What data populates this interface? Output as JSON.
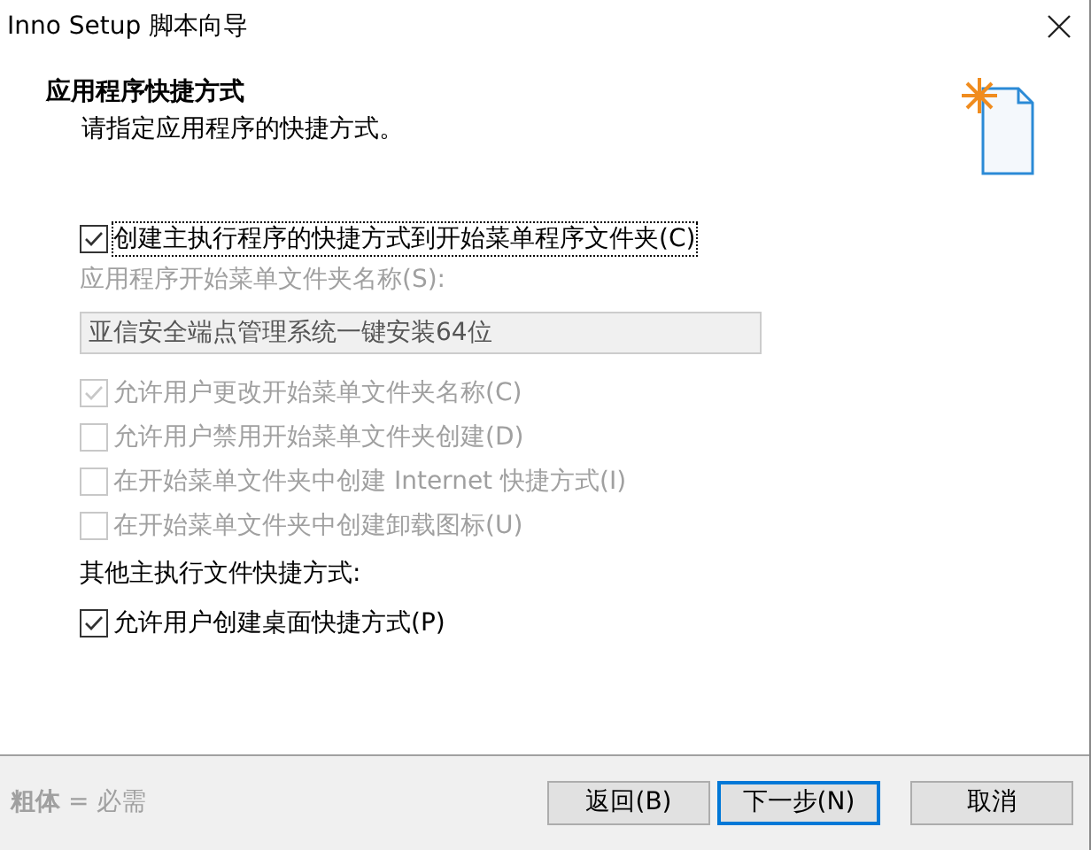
{
  "window": {
    "title": "Inno Setup 脚本向导"
  },
  "header": {
    "title": "应用程序快捷方式",
    "subtitle": "请指定应用程序的快捷方式。"
  },
  "start_menu": {
    "create": {
      "label": "创建主执行程序的快捷方式到开始菜单程序文件夹(C)",
      "checked": true,
      "disabled": false,
      "focused": true
    },
    "folder_label": {
      "text": "应用程序开始菜单文件夹名称(S):",
      "disabled": true
    },
    "folder_field": {
      "value": "亚信安全端点管理系统一键安装64位",
      "disabled": true
    },
    "options": [
      {
        "label": "允许用户更改开始菜单文件夹名称(C)",
        "checked": true,
        "disabled": true
      },
      {
        "label": "允许用户禁用开始菜单文件夹创建(D)",
        "checked": false,
        "disabled": true
      },
      {
        "label": "在开始菜单文件夹中创建 Internet 快捷方式(I)",
        "checked": false,
        "disabled": true
      },
      {
        "label": "在开始菜单文件夹中创建卸载图标(U)",
        "checked": false,
        "disabled": true
      }
    ]
  },
  "other": {
    "label": "其他主执行文件快捷方式:",
    "options": [
      {
        "label": "允许用户创建桌面快捷方式(P)",
        "checked": true,
        "disabled": false
      }
    ]
  },
  "footer": {
    "legend": "**粗体** = 必需",
    "buttons": [
      {
        "label": "返回(B)",
        "default": false
      },
      {
        "label": "下一步(N)",
        "default": true
      },
      {
        "label": "取消",
        "default": false
      }
    ]
  }
}
